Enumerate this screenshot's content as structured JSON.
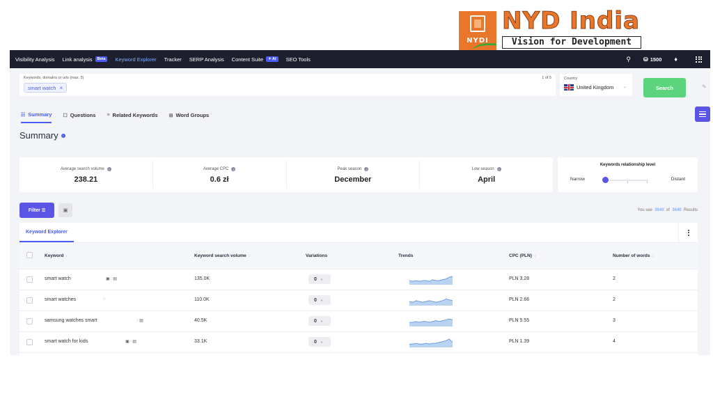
{
  "logo": {
    "badge_text": "NYDI",
    "name": "NYD India",
    "tagline": "Vision for Development"
  },
  "nav": {
    "items": [
      {
        "label": "Visibility Analysis",
        "badge": ""
      },
      {
        "label": "Link analysis",
        "badge": "Beta"
      },
      {
        "label": "Keyword Explorer",
        "badge": ""
      },
      {
        "label": "Tracker",
        "badge": ""
      },
      {
        "label": "SERP Analysis",
        "badge": ""
      },
      {
        "label": "Content Suite",
        "badge": "✦ AI"
      },
      {
        "label": "SEO Tools",
        "badge": ""
      }
    ],
    "active_index": 2,
    "credits": "1500"
  },
  "search": {
    "label": "Keywords, domains or urls (max. 5)",
    "count": "1 of 5",
    "chip": "smart watch",
    "button": "Search"
  },
  "country": {
    "label": "Country",
    "value": "United Kingdom"
  },
  "tabs": [
    {
      "label": "Summary",
      "icon": "summary-icon"
    },
    {
      "label": "Questions",
      "icon": "question-icon"
    },
    {
      "label": "Related Keywords",
      "icon": "related-icon"
    },
    {
      "label": "Word Groups",
      "icon": "groups-icon"
    }
  ],
  "summary": {
    "title": "Summary",
    "stats": [
      {
        "label": "Average search volume",
        "value": "238.21"
      },
      {
        "label": "Average CPC",
        "value": "0.6 zł"
      },
      {
        "label": "Peak season",
        "value": "December"
      },
      {
        "label": "Low season",
        "value": "April"
      }
    ],
    "relationship": {
      "title": "Keywords relationship level",
      "left": "Narrow",
      "right": "Distant",
      "level": 0
    }
  },
  "filters": {
    "filter_label": "Filter",
    "results_prefix": "You see",
    "shown": "3640",
    "results_of": "of",
    "total": "3640",
    "results_suffix": "Results"
  },
  "table": {
    "tab": "Keyword Explorer",
    "columns": [
      "Keyword",
      "Keyword search volume",
      "Variations",
      "Trends",
      "CPC (PLN)",
      "Number of words"
    ],
    "rows": [
      {
        "keyword": "smart watch",
        "icons": "▣◌▤",
        "volume": "135.0K",
        "variations": "0",
        "cpc": "PLN 3.28",
        "words": "2",
        "trend": [
          5,
          4,
          5,
          4,
          5,
          5,
          4,
          6,
          5,
          5,
          6,
          7,
          9,
          10
        ]
      },
      {
        "keyword": "smart watches",
        "icons": "◌",
        "volume": "110.0K",
        "variations": "0",
        "cpc": "PLN 2.66",
        "words": "2",
        "trend": [
          5,
          4,
          6,
          5,
          4,
          5,
          6,
          5,
          4,
          5,
          6,
          8,
          7,
          6
        ]
      },
      {
        "keyword": "samsung watches smart",
        "icons": "◌▤",
        "volume": "40.5K",
        "variations": "0",
        "cpc": "PLN 5.55",
        "words": "3",
        "trend": [
          5,
          5,
          6,
          5,
          6,
          6,
          5,
          6,
          7,
          6,
          7,
          8,
          9,
          8
        ]
      },
      {
        "keyword": "smart watch for kids",
        "icons": "▣◌▤",
        "volume": "33.1K",
        "variations": "0",
        "cpc": "PLN 1.39",
        "words": "4",
        "trend": [
          4,
          4,
          5,
          4,
          4,
          5,
          4,
          5,
          5,
          6,
          7,
          8,
          10,
          6
        ]
      }
    ]
  },
  "colors": {
    "nav_bg": "#1d1f2e",
    "accent": "#5b55e6",
    "search_green": "#5bd47d",
    "trend_fill": "#b9d3f2",
    "trend_line": "#5a8fd6"
  }
}
